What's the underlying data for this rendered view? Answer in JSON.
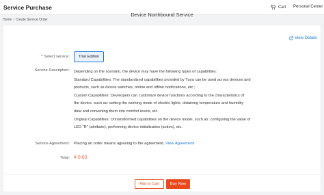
{
  "header": {
    "title": "Service Purchase",
    "cart_label": "Cart",
    "personal_center_label": "Personal Center"
  },
  "breadcrumb": {
    "home": "Home",
    "separator": "/",
    "current": "Create Service Order"
  },
  "service": {
    "title": "Device Northbound Service",
    "view_details_label": "View Details"
  },
  "form": {
    "select_service": {
      "required_marker": "*",
      "label": "Select service:",
      "selected_option": "Trial Edition"
    },
    "description": {
      "label": "Service Description:",
      "lines": [
        "Depending on the scenario, the device may have the following types of capabilities:",
        "Standard Capabilities: The standardized capabilities provided by Tuya can be used across devices and",
        "products, such as device switches, online and offline notifications, etc.;",
        "Custom Capabilities: Developers can customize device functions according to the characteristics of",
        "the device, such as: setting the working mode of electric lights, obtaining temperature and humidity",
        "data and converting them into comfort levels, etc.",
        "Original Capabilities: Untransformed capabilities on the device model, such as: configuring the value of",
        "LED \"R\" (attribute), performing device initialization (action), etc."
      ]
    },
    "agreement": {
      "label": "Service Agreement:",
      "text": "Placing an order means agreeing to the agreement,",
      "link_text": "View Agreement"
    },
    "total": {
      "label": "Total:",
      "value": "¥ 0.00"
    }
  },
  "actions": {
    "add_to_cart": "Add to Cart",
    "buy_now": "Buy Now"
  },
  "colors": {
    "accent_blue": "#1677d9",
    "price_orange": "#e8643a",
    "buy_button": "#e8491d"
  }
}
